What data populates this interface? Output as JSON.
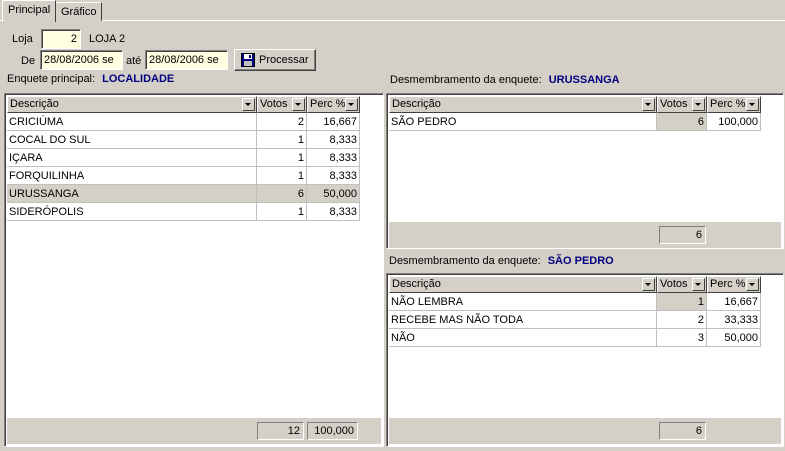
{
  "tabs": [
    {
      "label": "Principal"
    },
    {
      "label": "Gráfico"
    }
  ],
  "filters": {
    "loja_label": "Loja",
    "loja_value": "2",
    "loja_name": "LOJA 2",
    "de_label": "De",
    "de_value": "28/08/2006 se",
    "ate_label": "até",
    "ate_value": "28/08/2006 se",
    "process_label": "Processar"
  },
  "main_survey": {
    "label": "Enquete principal:",
    "value": "LOCALIDADE",
    "headers": {
      "descricao": "Descrição",
      "votos": "Votos",
      "perc": "Perc %"
    },
    "rows": [
      {
        "descricao": "CRICIÚMA",
        "votos": "2",
        "perc": "16,667"
      },
      {
        "descricao": "COCAL DO SUL",
        "votos": "1",
        "perc": "8,333"
      },
      {
        "descricao": "IÇARA",
        "votos": "1",
        "perc": "8,333"
      },
      {
        "descricao": "FORQUILINHA",
        "votos": "1",
        "perc": "8,333"
      },
      {
        "descricao": "URUSSANGA",
        "votos": "6",
        "perc": "50,000"
      },
      {
        "descricao": "SIDERÓPOLIS",
        "votos": "1",
        "perc": "8,333"
      }
    ],
    "total_votos": "12",
    "total_perc": "100,000"
  },
  "breakdown1": {
    "label": "Desmembramento da enquete:",
    "value": "URUSSANGA",
    "headers": {
      "descricao": "Descrição",
      "votos": "Votos",
      "perc": "Perc %"
    },
    "rows": [
      {
        "descricao": "SÃO PEDRO",
        "votos": "6",
        "perc": "100,000"
      }
    ],
    "total_votos": "6"
  },
  "breakdown2": {
    "label": "Desmembramento da enquete:",
    "value": "SÃO PEDRO",
    "headers": {
      "descricao": "Descrição",
      "votos": "Votos",
      "perc": "Perc %"
    },
    "rows": [
      {
        "descricao": "NÃO LEMBRA",
        "votos": "1",
        "perc": "16,667"
      },
      {
        "descricao": "RECEBE MAS NÃO TODA",
        "votos": "2",
        "perc": "33,333"
      },
      {
        "descricao": "NÃO",
        "votos": "3",
        "perc": "50,000"
      }
    ],
    "total_votos": "6"
  }
}
